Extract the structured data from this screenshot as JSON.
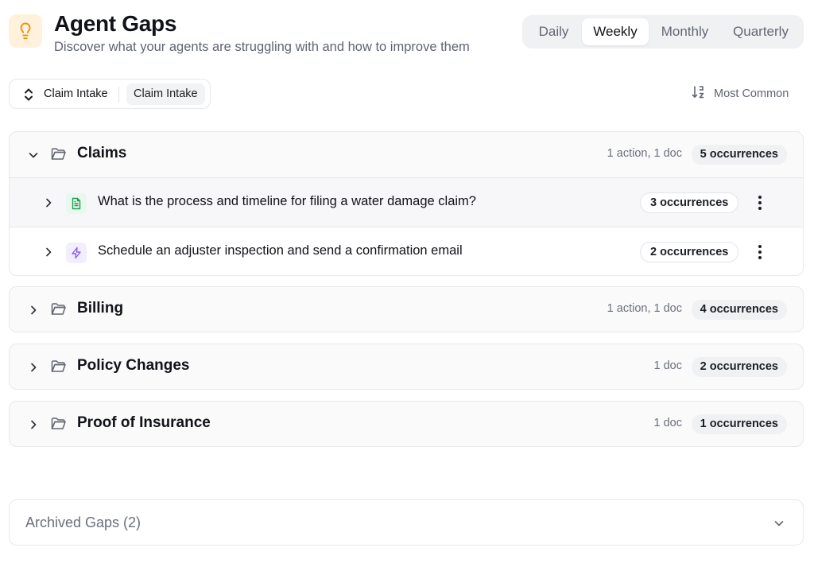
{
  "header": {
    "title": "Agent Gaps",
    "subtitle": "Discover what your agents are struggling with and how to improve them",
    "icon": "lightbulb-icon"
  },
  "periods": [
    {
      "label": "Daily",
      "active": false
    },
    {
      "label": "Weekly",
      "active": true
    },
    {
      "label": "Monthly",
      "active": false
    },
    {
      "label": "Quarterly",
      "active": false
    }
  ],
  "selector": {
    "label": "Claim Intake",
    "chip": "Claim Intake"
  },
  "sort": {
    "label": "Most Common"
  },
  "groups": [
    {
      "name": "Claims",
      "meta": "1 action, 1 doc",
      "occurrences": "5 occurrences",
      "expanded": true,
      "items": [
        {
          "type": "doc",
          "text": "What is the process and timeline for filing a water damage claim?",
          "occurrences": "3 occurrences"
        },
        {
          "type": "action",
          "text": "Schedule an adjuster inspection and send a confirmation email",
          "occurrences": "2 occurrences"
        }
      ]
    },
    {
      "name": "Billing",
      "meta": "1 action, 1 doc",
      "occurrences": "4 occurrences",
      "expanded": false
    },
    {
      "name": "Policy Changes",
      "meta": "1 doc",
      "occurrences": "2 occurrences",
      "expanded": false
    },
    {
      "name": "Proof of Insurance",
      "meta": "1 doc",
      "occurrences": "1 occurrences",
      "expanded": false
    }
  ],
  "archived": {
    "label": "Archived Gaps (2)"
  },
  "colors": {
    "accent_bulb": "#e8930c",
    "bulb_bg": "#fff1dc",
    "doc_icon": "#1f9d55",
    "action_icon": "#8b5cf6"
  }
}
